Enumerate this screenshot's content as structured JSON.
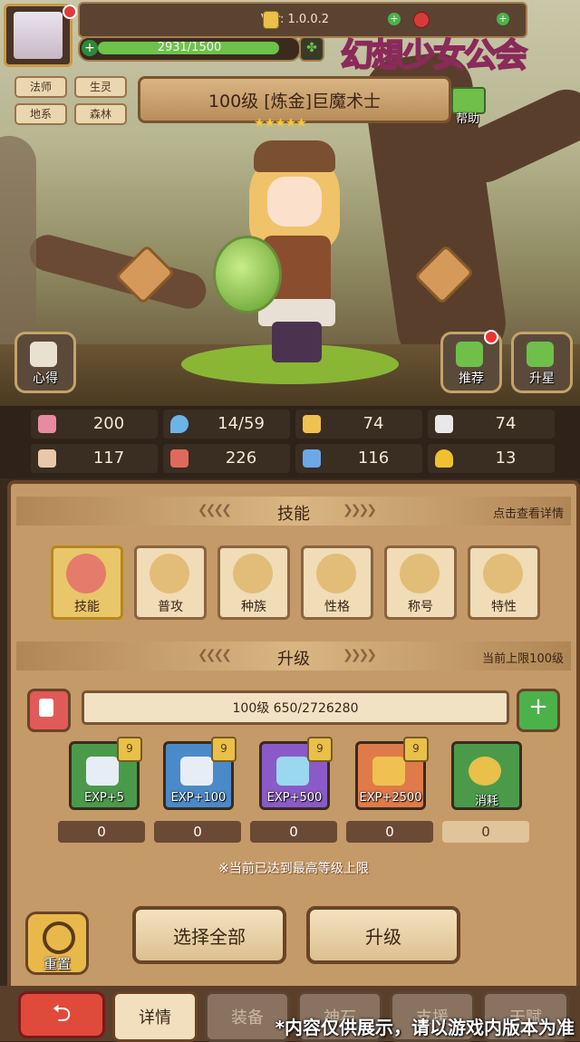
{
  "header": {
    "version": "Ver: 1.0.0.2",
    "exp_text": "2931/1500",
    "logo_text": "幻想少女公会"
  },
  "tags": [
    "法师",
    "生灵",
    "地系",
    "森林"
  ],
  "hero": {
    "title": "100级 [炼金]巨魔术士",
    "stars": "★★★★★",
    "help_label": "帮助"
  },
  "side_buttons": {
    "insight": "心得",
    "recommend": "推荐",
    "star_up": "升星"
  },
  "stats": [
    {
      "icon": "heart-icon",
      "value": "200",
      "color": "#e88aa0"
    },
    {
      "icon": "water-drop-icon",
      "value": "14/59",
      "color": "#6ab4e8"
    },
    {
      "icon": "shield-icon",
      "value": "74",
      "color": "#f0c050"
    },
    {
      "icon": "wing-icon",
      "value": "74",
      "color": "#e8e8e8"
    },
    {
      "icon": "fist-icon",
      "value": "117",
      "color": "#e8c8a8"
    },
    {
      "icon": "book-icon",
      "value": "226",
      "color": "#e06a5a"
    },
    {
      "icon": "scroll-icon",
      "value": "116",
      "color": "#6aa8e8"
    },
    {
      "icon": "horseshoe-icon",
      "value": "13",
      "color": "#f0c030"
    }
  ],
  "skills_section": {
    "title": "技能",
    "right_text": "点击查看详情",
    "items": [
      "技能",
      "普攻",
      "种族",
      "性格",
      "称号",
      "特性"
    ]
  },
  "upgrade_section": {
    "title": "升级",
    "right_text": "当前上限100级",
    "level_text": "100级  650/2726280",
    "items": [
      {
        "label": "EXP+5",
        "count": "0",
        "badge": "9",
        "bg": "#4a9a4a"
      },
      {
        "label": "EXP+100",
        "count": "0",
        "badge": "9",
        "bg": "#4a8ac8"
      },
      {
        "label": "EXP+500",
        "count": "0",
        "badge": "9",
        "bg": "#8a5ac8"
      },
      {
        "label": "EXP+2500",
        "count": "0",
        "badge": "9",
        "bg": "#e07a4a"
      },
      {
        "label": "消耗",
        "count": "0",
        "badge": "",
        "bg": "#4a9a4a"
      }
    ],
    "note": "※当前已达到最高等级上限"
  },
  "actions": {
    "reset": "重置",
    "select_all": "选择全部",
    "upgrade": "升级"
  },
  "tabs": [
    "详情",
    "装备",
    "神石",
    "支援",
    "天赋"
  ],
  "disclaimer": "*内容仅供展示，请以游戏内版本为准"
}
